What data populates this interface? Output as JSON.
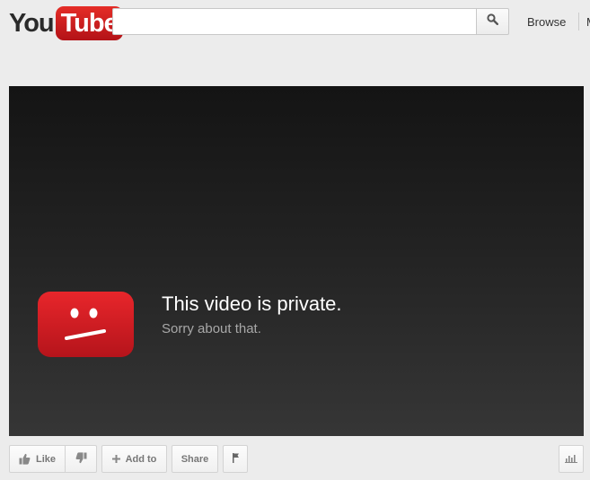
{
  "header": {
    "logo": {
      "part1": "You",
      "part2": "Tube"
    },
    "search": {
      "placeholder": "",
      "value": "",
      "button_icon": "search-icon"
    },
    "nav": {
      "browse_label": "Browse",
      "next_item_partial": "M"
    }
  },
  "player": {
    "error_icon": "sad-tv-icon",
    "title": "This video is private.",
    "subtitle": "Sorry about that."
  },
  "actions": {
    "like_label": "Like",
    "dislike_icon": "thumbs-down-icon",
    "add_to_label": "Add to",
    "share_label": "Share",
    "flag_icon": "flag-icon",
    "stats_icon": "stats-icon"
  },
  "colors": {
    "brand_red": "#e52d27",
    "background": "#ececec",
    "player_top": "#141414",
    "player_bottom": "#363636"
  }
}
